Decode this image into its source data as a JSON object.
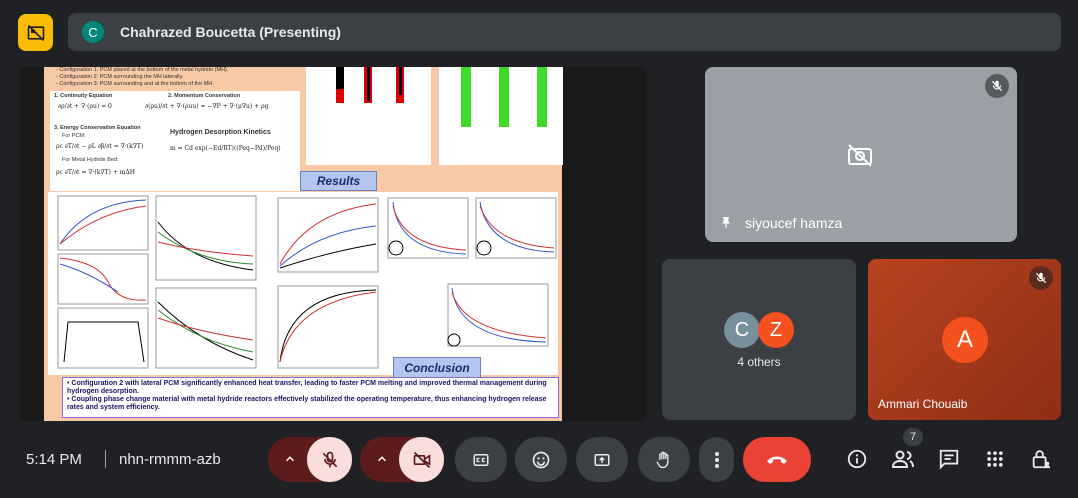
{
  "header": {
    "presenter_initial": "C",
    "presenter_label": "Chahrazed Boucetta (Presenting)",
    "pin_icon": "hide-self-view-icon",
    "accent": "#fbbc04"
  },
  "slide": {
    "config_lines": [
      "- Configuration 1: PCM placed at the bottom of the metal hydride (MH).",
      "- Configuration 2: PCM surrounding the MH laterally.",
      "- Configuration 3: PCM surrounding and at the bottom of the MH."
    ],
    "eq_continuity": "1. Continuity Equation",
    "eq_momentum": "2. Momentum Conservation",
    "eq_energy": "3. Energy Conservation Equation",
    "eq_for_pcm": "For PCM:",
    "eq_for_mh": "For Metal Hydride Bed:",
    "eq_kinetics": "Hydrogen Desorption Kinetics",
    "results_title": "Results",
    "conclusion_title": "Conclusion",
    "conclusion_1": "Configuration 2 with lateral PCM significantly enhanced heat transfer, leading to faster PCM melting and improved thermal management during hydrogen desorption.",
    "conclusion_2": "Coupling phase change material with metal hydride reactors effectively stabilized the operating temperature, thus enhancing hydrogen release rates and system efficiency."
  },
  "participants": {
    "pinned": {
      "name": "siyoucef hamza",
      "muted": true
    },
    "others": {
      "initials": [
        "C",
        "Z"
      ],
      "label": "4 others",
      "colors": [
        "#78909c",
        "#f4511e"
      ]
    },
    "third": {
      "initial": "A",
      "name": "Ammari Chouaib",
      "muted": true,
      "color": "#f4511e"
    }
  },
  "footer": {
    "time": "5:14 PM",
    "meeting_code": "nhn-rmmm-azb",
    "people_count": "7"
  }
}
